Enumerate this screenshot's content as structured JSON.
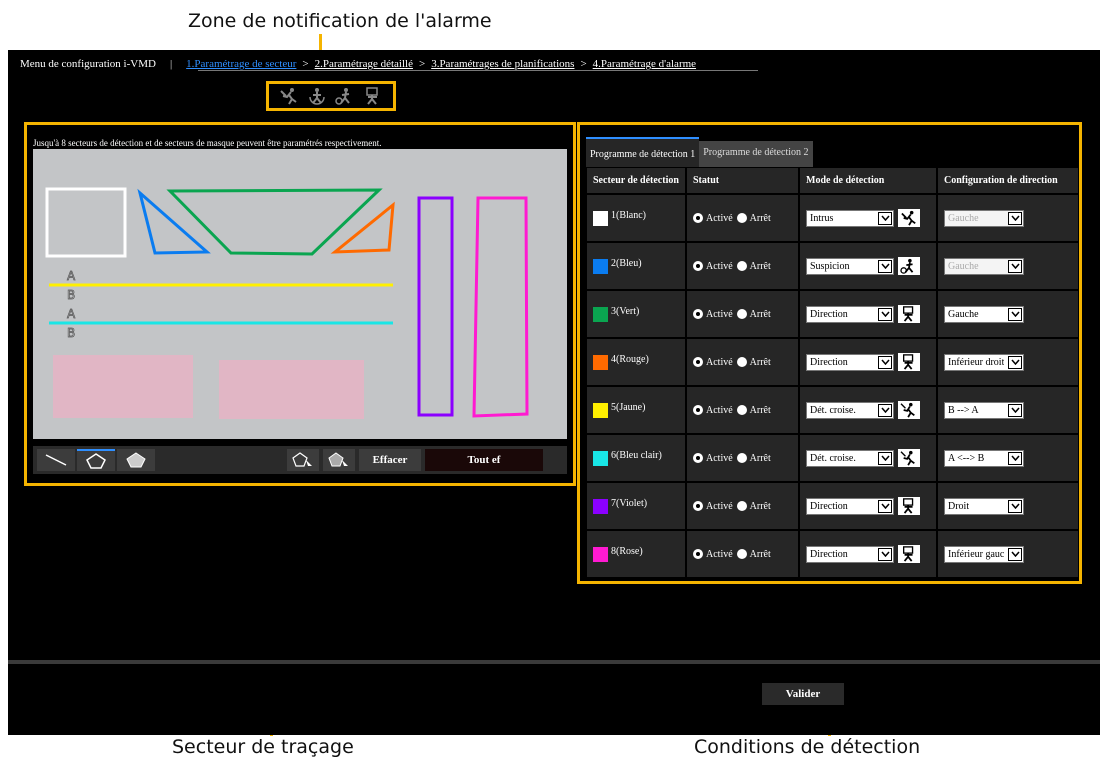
{
  "callouts": {
    "alarm_zone": "Zone de notification de l'alarme",
    "drawing_area": "Secteur de traçage",
    "conditions": "Conditions de détection"
  },
  "nav": {
    "menu_title": "Menu de configuration i-VMD",
    "separator": "|",
    "arrow": ">",
    "steps": [
      "1.Paramétrage de secteur",
      "2.Paramétrage détaillé",
      "3.Paramétrages de planifications",
      "4.Paramétrage d'alarme"
    ]
  },
  "alarm_icons": [
    "intruder-icon",
    "loitering-icon",
    "suspicion-icon",
    "direction-icon"
  ],
  "drawing": {
    "note": "Jusqu'à 8 secteurs de détection et de secteurs de masque peuvent être paramétrés respectivement.",
    "line_labels": [
      "A",
      "B",
      "A",
      "B"
    ],
    "tools": [
      "line-tool-icon",
      "polygon-tool-icon",
      "filled-polygon-tool-icon"
    ],
    "erase_label": "Effacer",
    "erase_all_label": "Tout ef"
  },
  "colors": {
    "accent": "#f5b400",
    "active_link": "#2f8fff",
    "white": "#ffffff",
    "blue": "#0a7cf0",
    "green": "#0aa550",
    "orange": "#ff6a00",
    "yellow": "#ffef00",
    "light_blue": "#19e6e6",
    "purple": "#8b00ff",
    "pink": "#ff1ad1",
    "mask": "#e6b3c4"
  },
  "conditions": {
    "tabs": [
      "Programme de détection 1",
      "Programme de détection 2"
    ],
    "headers": [
      "Secteur de détection",
      "Statut",
      "Mode de détection",
      "Configuration de direction"
    ],
    "status_on": "Activé",
    "status_off": "Arrêt",
    "rows": [
      {
        "label": "1(Blanc)",
        "color": "#ffffff",
        "mode": "Intrus",
        "mode_icon": "intruder-icon",
        "direction": "Gauche",
        "direction_disabled": true
      },
      {
        "label": "2(Bleu)",
        "color": "#0a7cf0",
        "mode": "Suspicion",
        "mode_icon": "suspicion-icon",
        "direction": "Gauche",
        "direction_disabled": true
      },
      {
        "label": "3(Vert)",
        "color": "#0aa550",
        "mode": "Direction",
        "mode_icon": "direction-icon",
        "direction": "Gauche",
        "direction_disabled": false
      },
      {
        "label": "4(Rouge)",
        "color": "#ff6a00",
        "mode": "Direction",
        "mode_icon": "direction-icon",
        "direction": "Inférieur droit",
        "direction_disabled": false
      },
      {
        "label": "5(Jaune)",
        "color": "#ffef00",
        "mode": "Dét. croise.",
        "mode_icon": "cross-line-icon",
        "direction": "B --> A",
        "direction_disabled": false
      },
      {
        "label": "6(Bleu clair)",
        "color": "#19e6e6",
        "mode": "Dét. croise.",
        "mode_icon": "cross-line-icon",
        "direction": "A <--> B",
        "direction_disabled": false
      },
      {
        "label": "7(Violet)",
        "color": "#8b00ff",
        "mode": "Direction",
        "mode_icon": "direction-icon",
        "direction": "Droit",
        "direction_disabled": false
      },
      {
        "label": "8(Rose)",
        "color": "#ff1ad1",
        "mode": "Direction",
        "mode_icon": "direction-icon",
        "direction": "Inférieur gauc",
        "direction_disabled": false
      }
    ]
  },
  "submit_label": "Valider"
}
